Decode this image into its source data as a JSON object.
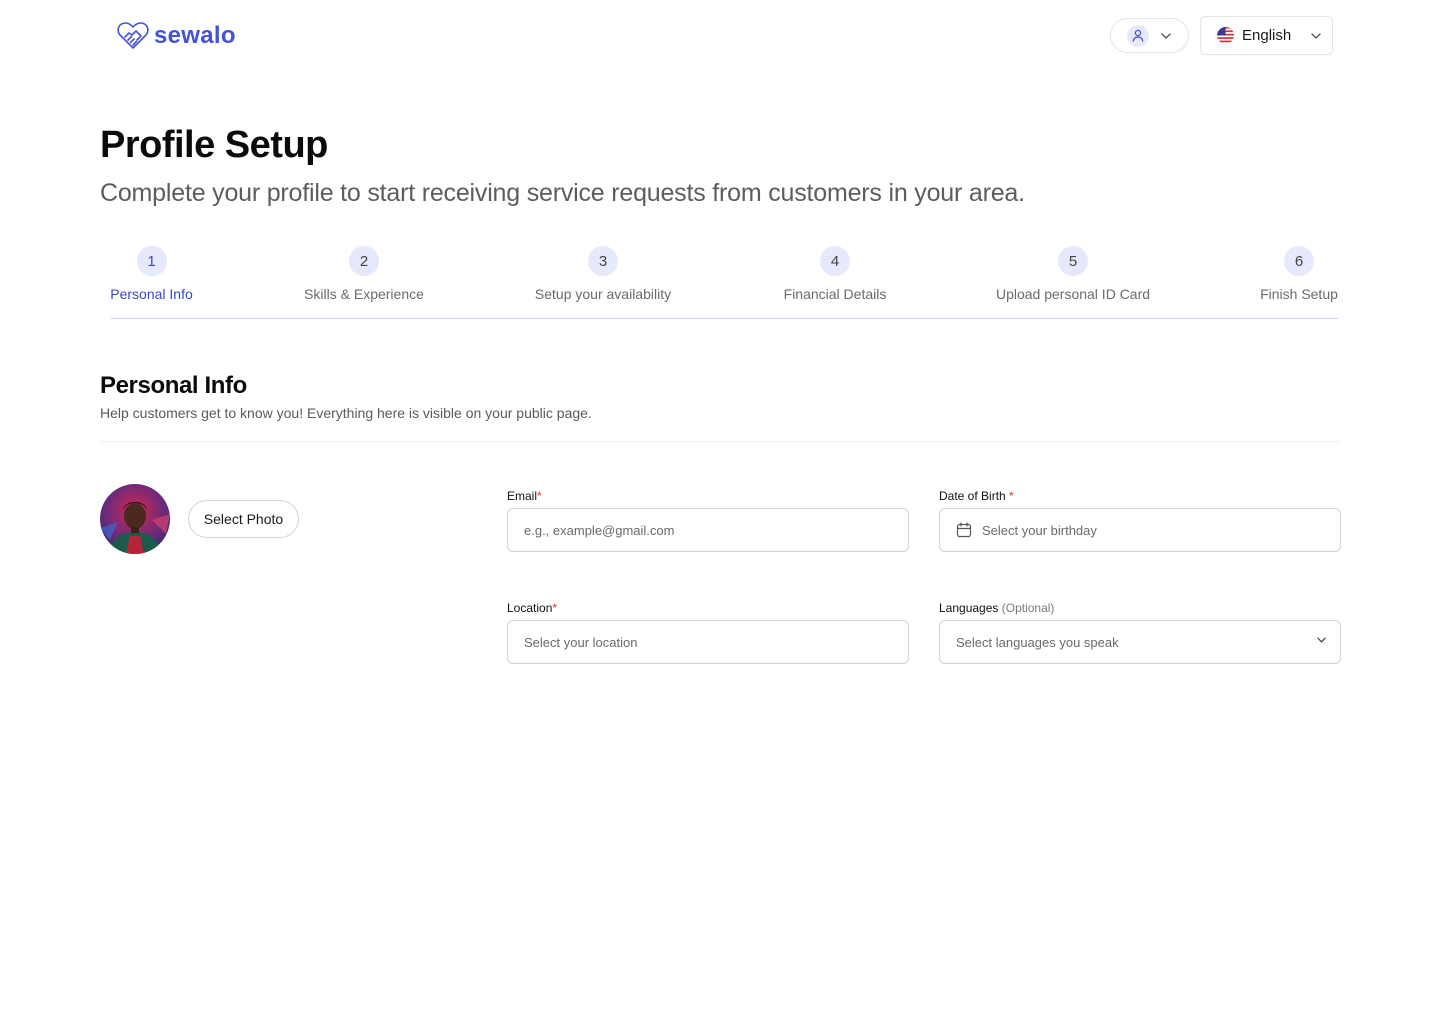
{
  "brand": {
    "name": "sewalo",
    "accent": "#4353d4"
  },
  "header": {
    "user_menu": {
      "icon": "user-icon"
    },
    "language": {
      "label": "English",
      "icon": "us-flag-icon"
    }
  },
  "page": {
    "title": "Profile Setup",
    "subtitle": "Complete your profile to start receiving service requests from customers in your area."
  },
  "stepper": {
    "active_index": 0,
    "steps": [
      {
        "number": "1",
        "label": "Personal Info"
      },
      {
        "number": "2",
        "label": "Skills & Experience"
      },
      {
        "number": "3",
        "label": "Setup your availability"
      },
      {
        "number": "4",
        "label": "Financial Details"
      },
      {
        "number": "5",
        "label": "Upload personal ID Card"
      },
      {
        "number": "6",
        "label": "Finish Setup"
      }
    ]
  },
  "section": {
    "title": "Personal Info",
    "description": "Help customers get to know you! Everything here is visible on your public page."
  },
  "photo": {
    "button_label": "Select Photo"
  },
  "form": {
    "email": {
      "label": "Email",
      "required_mark": "*",
      "placeholder": "e.g., example@gmail.com",
      "value": ""
    },
    "dob": {
      "label": "Date of Birth ",
      "required_mark": "*",
      "placeholder": "Select your birthday",
      "icon": "calendar-icon"
    },
    "location": {
      "label": "Location",
      "required_mark": "*",
      "placeholder": "Select your location"
    },
    "languages": {
      "label": "Languages ",
      "optional_label": "(Optional)",
      "placeholder": "Select languages you speak",
      "icon": "chevron-down-icon"
    }
  },
  "colors": {
    "required": "#e03131",
    "step_circle": "#e5e9fb",
    "active_step": "#3a48c6"
  }
}
